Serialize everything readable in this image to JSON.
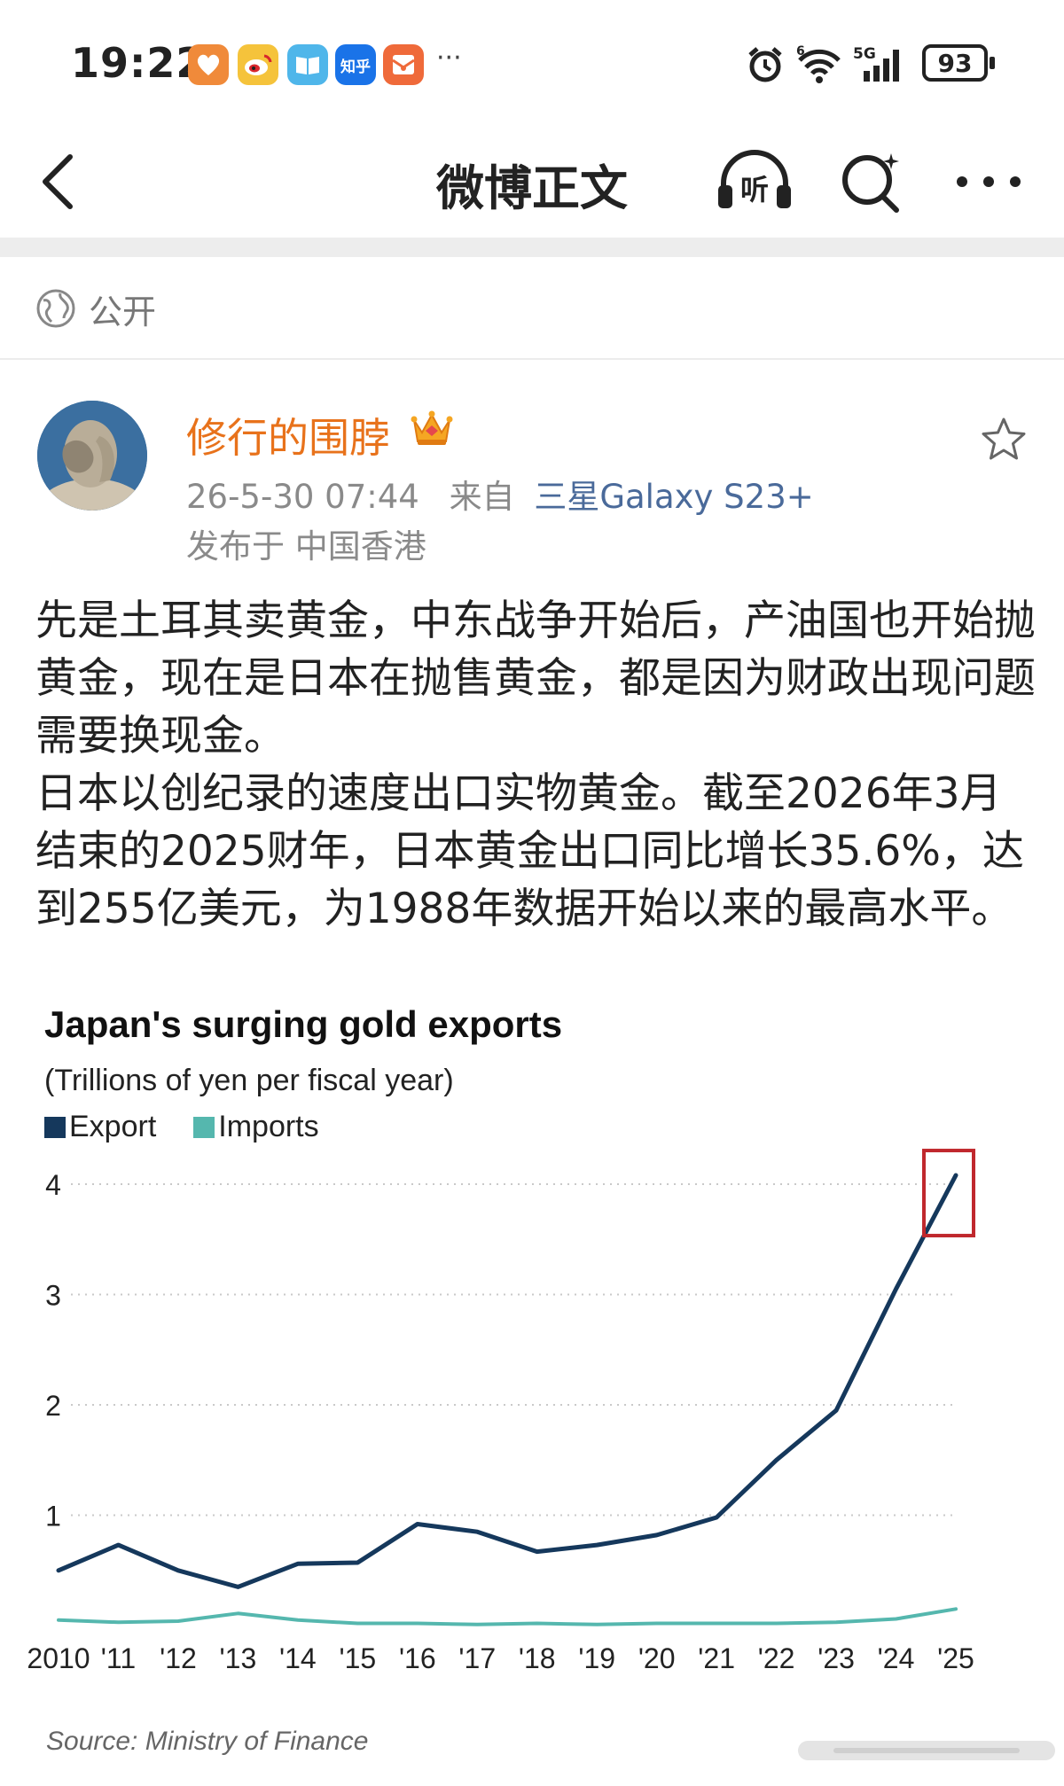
{
  "status_bar": {
    "time": "19:22",
    "network_label": "5G",
    "wifi_label": "6",
    "battery": "93",
    "more_label": "···",
    "apps": [
      {
        "name": "heart-app-icon",
        "color": "#f08a3a",
        "label": ""
      },
      {
        "name": "weibo-app-icon",
        "color": "#f5c33b",
        "label": ""
      },
      {
        "name": "book-app-icon",
        "color": "#4fb6ea",
        "label": ""
      },
      {
        "name": "zhihu-app-icon",
        "color": "#1a73e8",
        "label": "知乎"
      },
      {
        "name": "mail-app-icon",
        "color": "#ef6a3a",
        "label": ""
      }
    ]
  },
  "nav": {
    "title": "微博正文",
    "listen_label": "听"
  },
  "post": {
    "visibility": "公开",
    "author": "修行的围脖",
    "timestamp": "26-5-30 07:44",
    "source_prefix": "来自",
    "device": "三星Galaxy S23+",
    "location": "发布于 中国香港",
    "paragraph_1": "先是土耳其卖黄金，中东战争开始后，产油国也开始抛黄金，现在是日本在抛售黄金，都是因为财政出现问题需要换现金。",
    "paragraph_2": "日本以创纪录的速度出口实物黄金。截至2026年3月结束的2025财年，日本黄金出口同比增长35.6%，达到255亿美元，为1988年数据开始以来的最高水平。"
  },
  "chart_data": {
    "type": "line",
    "title": "Japan's surging gold exports",
    "subtitle": "(Trillions of yen per fiscal year)",
    "source": "Source: Ministry of Finance",
    "categories": [
      "2010",
      "'11",
      "'12",
      "'13",
      "'14",
      "'15",
      "'16",
      "'17",
      "'18",
      "'19",
      "'20",
      "'21",
      "'22",
      "'23",
      "'24",
      "'25"
    ],
    "series": [
      {
        "name": "Export",
        "color": "#15385c",
        "values": [
          0.5,
          0.73,
          0.5,
          0.35,
          0.56,
          0.57,
          0.92,
          0.85,
          0.67,
          0.73,
          0.82,
          0.98,
          1.5,
          1.95,
          3.05,
          4.08
        ]
      },
      {
        "name": "Imports",
        "color": "#55b7ae",
        "values": [
          0.05,
          0.03,
          0.04,
          0.11,
          0.05,
          0.02,
          0.02,
          0.01,
          0.02,
          0.01,
          0.02,
          0.02,
          0.02,
          0.03,
          0.06,
          0.15
        ]
      }
    ],
    "yticks": [
      "1",
      "2",
      "3",
      "4"
    ],
    "ylim": [
      0,
      4.5
    ],
    "grid": true,
    "legend": "top-left",
    "highlight": "'25",
    "highlight_color": "#c0282d"
  }
}
